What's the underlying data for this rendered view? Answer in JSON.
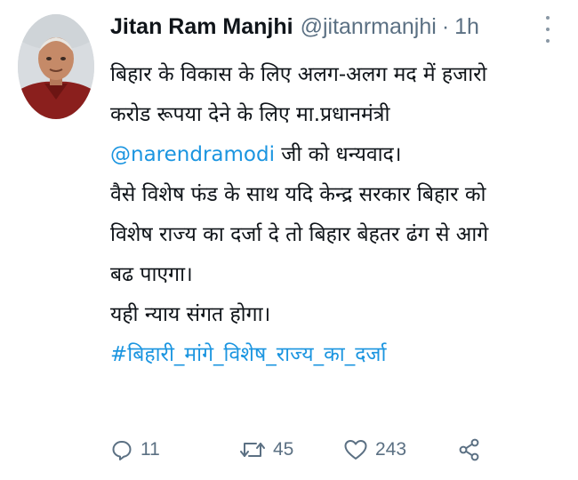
{
  "tweet": {
    "display_name": "Jitan Ram Manjhi",
    "handle": "@jitanrmanjhi",
    "separator": "·",
    "time": "1h",
    "body": {
      "line1": "बिहार के विकास के लिए अलग-अलग मद में हजारो",
      "line2": "करोड रूपया देने के लिए मा.प्रधानमंत्री",
      "line3_mention": "@narendramodi",
      "line3_rest": " जी को धन्यवाद।",
      "line4": "वैसे विशेष फंड के साथ यदि केन्द्र सरकार बिहार को",
      "line5": "विशेष राज्य का दर्जा दे तो बिहार बेहतर ढंग से आगे",
      "line6": "बढ पाएगा।",
      "line7": "यही न्याय संगत होगा।",
      "hashtag": "#बिहारी_मांगे_विशेष_राज्य_का_दर्जा"
    },
    "actions": {
      "replies": "11",
      "retweets": "45",
      "likes": "243"
    },
    "icons": {
      "avatar": "profile-photo",
      "more": "more-options-icon",
      "reply": "reply-icon",
      "retweet": "retweet-icon",
      "like": "heart-icon",
      "share": "share-icon"
    },
    "colors": {
      "link": "#1b95e0",
      "secondary_text": "#5b7083",
      "primary_text": "#0f1419"
    }
  }
}
